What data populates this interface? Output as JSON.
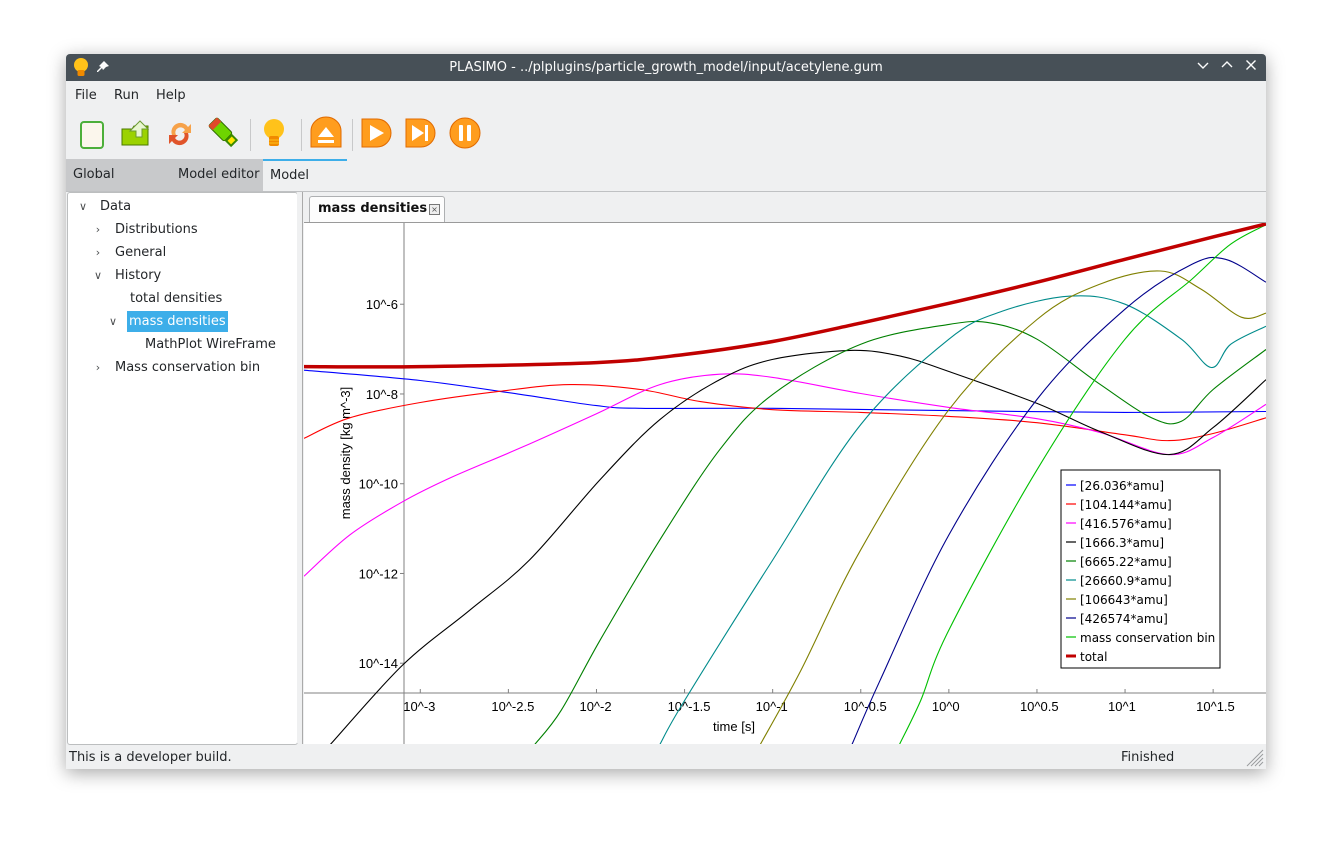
{
  "window": {
    "title": "PLASIMO - ../plplugins/particle_growth_model/input/acetylene.gum",
    "app_icon": "lightbulb-icon",
    "pin_icon": "pin-icon",
    "controls": [
      "minimize",
      "maximize",
      "close"
    ]
  },
  "menu": [
    "File",
    "Run",
    "Help"
  ],
  "toolbar": [
    {
      "name": "new-button",
      "icon": "new-document-icon"
    },
    {
      "name": "open-button",
      "icon": "open-folder-icon"
    },
    {
      "name": "reload-button",
      "icon": "reload-icon"
    },
    {
      "name": "save-button",
      "icon": "usb-save-icon"
    },
    {
      "name": "plasimo-button",
      "icon": "lightbulb-icon"
    },
    {
      "name": "eject-button",
      "icon": "eject-icon"
    },
    {
      "name": "run-button",
      "icon": "play-icon"
    },
    {
      "name": "step-button",
      "icon": "step-forward-icon"
    },
    {
      "name": "pause-button",
      "icon": "pause-icon"
    }
  ],
  "tabs": [
    {
      "label": "Global settings",
      "active": false
    },
    {
      "label": "Model editor",
      "active": false
    },
    {
      "label": "Model data",
      "active": true
    }
  ],
  "tree": [
    {
      "label": "Data",
      "level": 0,
      "expanded": true
    },
    {
      "label": "Distributions",
      "level": 1,
      "expanded": false
    },
    {
      "label": "General",
      "level": 1,
      "expanded": false
    },
    {
      "label": "History",
      "level": 1,
      "expanded": true
    },
    {
      "label": "total densities",
      "level": 2,
      "leaf": true
    },
    {
      "label": "mass densities",
      "level": 2,
      "expanded": true,
      "selected": true
    },
    {
      "label": "MathPlot WireFrame",
      "level": 3,
      "leaf": true
    },
    {
      "label": "Mass conservation bin",
      "level": 1,
      "expanded": false
    }
  ],
  "plot_tab": {
    "label": "mass densities",
    "close_icon": "close-icon"
  },
  "status": {
    "left": "This is a developer build.",
    "right": "Finished"
  },
  "chart_data": {
    "type": "line",
    "title": "",
    "xlabel": "time [s]",
    "ylabel": "mass density [kg m^-3]",
    "xscale": "log10",
    "yscale": "log10",
    "xlim_log10": [
      -3.66,
      1.8
    ],
    "ylim_log10": [
      -15.8,
      -4.19
    ],
    "xticks": [
      "10^-3",
      "10^-2.5",
      "10^-2",
      "10^-1.5",
      "10^-1",
      "10^-0.5",
      "10^0",
      "10^0.5",
      "10^1",
      "10^1.5"
    ],
    "xtick_values_log10": [
      -3,
      -2.5,
      -2,
      -1.5,
      -1,
      -0.5,
      0,
      0.5,
      1,
      1.5
    ],
    "yticks": [
      "10^-6",
      "10^-8",
      "10^-10",
      "10^-12",
      "10^-14"
    ],
    "ytick_values_log10": [
      -6,
      -8,
      -10,
      -12,
      -14
    ],
    "grid": false,
    "legend_position": "bottom-right",
    "note": "points are [log10(time), log10(mass density)]",
    "series": [
      {
        "name": "[26.036*amu]",
        "color": "#0000ff",
        "points": [
          [
            -3.66,
            -7.47
          ],
          [
            -3,
            -7.7
          ],
          [
            -2.43,
            -8.01
          ],
          [
            -2,
            -8.26
          ],
          [
            -1.75,
            -8.32
          ],
          [
            -1,
            -8.32
          ],
          [
            0,
            -8.37
          ],
          [
            1,
            -8.41
          ],
          [
            1.8,
            -8.39
          ]
        ]
      },
      {
        "name": "[104.144*amu]",
        "color": "#ff0000",
        "points": [
          [
            -3.66,
            -8.99
          ],
          [
            -3.4,
            -8.53
          ],
          [
            -3,
            -8.19
          ],
          [
            -2.55,
            -7.94
          ],
          [
            -2.15,
            -7.79
          ],
          [
            -1.75,
            -7.9
          ],
          [
            -1.41,
            -8.17
          ],
          [
            -1,
            -8.35
          ],
          [
            -0.5,
            -8.41
          ],
          [
            0,
            -8.5
          ],
          [
            0.5,
            -8.64
          ],
          [
            1,
            -8.91
          ],
          [
            1.25,
            -9.04
          ],
          [
            1.5,
            -8.88
          ],
          [
            1.8,
            -8.53
          ]
        ]
      },
      {
        "name": "[416.576*amu]",
        "color": "#ff00ff",
        "points": [
          [
            -3.66,
            -12.06
          ],
          [
            -3.4,
            -11.14
          ],
          [
            -3.1,
            -10.4
          ],
          [
            -2.83,
            -9.87
          ],
          [
            -2.43,
            -9.2
          ],
          [
            -2,
            -8.44
          ],
          [
            -1.64,
            -7.79
          ],
          [
            -1.3,
            -7.56
          ],
          [
            -1,
            -7.63
          ],
          [
            -0.5,
            -7.99
          ],
          [
            0,
            -8.3
          ],
          [
            0.5,
            -8.55
          ],
          [
            0.86,
            -8.86
          ],
          [
            1.25,
            -9.35
          ],
          [
            1.5,
            -8.97
          ],
          [
            1.8,
            -8.23
          ]
        ]
      },
      {
        "name": "[1666.3*amu]",
        "color": "#000000",
        "points": [
          [
            -3.51,
            -15.81
          ],
          [
            -3.1,
            -14.04
          ],
          [
            -2.72,
            -12.82
          ],
          [
            -2.38,
            -11.7
          ],
          [
            -1.98,
            -9.91
          ],
          [
            -1.64,
            -8.57
          ],
          [
            -1.3,
            -7.68
          ],
          [
            -1,
            -7.23
          ],
          [
            -0.56,
            -7.03
          ],
          [
            -0.27,
            -7.16
          ],
          [
            0,
            -7.5
          ],
          [
            0.5,
            -8.21
          ],
          [
            0.86,
            -8.84
          ],
          [
            1.25,
            -9.35
          ],
          [
            1.5,
            -8.75
          ],
          [
            1.8,
            -7.68
          ]
        ]
      },
      {
        "name": "[6665.22*amu]",
        "color": "#008000",
        "points": [
          [
            -2.35,
            -15.81
          ],
          [
            -2.2,
            -15.05
          ],
          [
            -1.98,
            -13.49
          ],
          [
            -1.64,
            -11.25
          ],
          [
            -1.3,
            -9.24
          ],
          [
            -1,
            -8.01
          ],
          [
            -0.5,
            -6.89
          ],
          [
            0,
            -6.45
          ],
          [
            0.24,
            -6.42
          ],
          [
            0.5,
            -6.78
          ],
          [
            0.86,
            -7.79
          ],
          [
            1.15,
            -8.53
          ],
          [
            1.32,
            -8.61
          ],
          [
            1.5,
            -7.9
          ],
          [
            1.8,
            -7.01
          ]
        ]
      },
      {
        "name": "[26660.9*amu]",
        "color": "#008b8b",
        "points": [
          [
            -1.64,
            -15.81
          ],
          [
            -1.5,
            -14.83
          ],
          [
            -1,
            -11.7
          ],
          [
            -0.5,
            -8.68
          ],
          [
            0,
            -6.78
          ],
          [
            0.3,
            -6.16
          ],
          [
            0.69,
            -5.82
          ],
          [
            1,
            -6.0
          ],
          [
            1.32,
            -6.78
          ],
          [
            1.49,
            -7.41
          ],
          [
            1.6,
            -6.89
          ],
          [
            1.8,
            -6.49
          ]
        ]
      },
      {
        "name": "[106643*amu]",
        "color": "#808000",
        "points": [
          [
            -1.07,
            -15.81
          ],
          [
            -0.84,
            -14.16
          ],
          [
            -0.5,
            -11.47
          ],
          [
            0,
            -8.35
          ],
          [
            0.5,
            -6.34
          ],
          [
            0.86,
            -5.55
          ],
          [
            1.2,
            -5.26
          ],
          [
            1.43,
            -5.66
          ],
          [
            1.66,
            -6.29
          ],
          [
            1.8,
            -6.2
          ]
        ]
      },
      {
        "name": "[426574*amu]",
        "color": "#00008b",
        "points": [
          [
            -0.55,
            -15.81
          ],
          [
            -0.39,
            -14.38
          ],
          [
            0,
            -11.14
          ],
          [
            0.5,
            -8.12
          ],
          [
            1,
            -6.11
          ],
          [
            1.38,
            -5.11
          ],
          [
            1.57,
            -5.0
          ],
          [
            1.8,
            -5.51
          ]
        ]
      },
      {
        "name": "mass conservation bin",
        "color": "#00c000",
        "points": [
          [
            -0.28,
            -15.81
          ],
          [
            -0.16,
            -14.83
          ],
          [
            0,
            -13.26
          ],
          [
            0.5,
            -9.69
          ],
          [
            1,
            -6.78
          ],
          [
            1.38,
            -5.44
          ],
          [
            1.6,
            -4.66
          ],
          [
            1.8,
            -4.23
          ]
        ]
      },
      {
        "name": "total",
        "color": "#c00000",
        "thick": true,
        "points": [
          [
            -3.66,
            -7.39
          ],
          [
            -3,
            -7.39
          ],
          [
            -2,
            -7.3
          ],
          [
            -1.5,
            -7.12
          ],
          [
            -1,
            -6.83
          ],
          [
            -0.5,
            -6.42
          ],
          [
            0,
            -5.98
          ],
          [
            0.5,
            -5.51
          ],
          [
            1,
            -5.0
          ],
          [
            1.5,
            -4.5
          ],
          [
            1.8,
            -4.21
          ]
        ]
      }
    ]
  }
}
